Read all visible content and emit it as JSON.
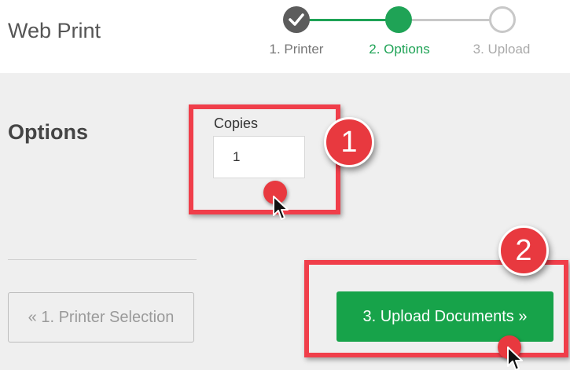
{
  "header": {
    "app_title": "Web Print"
  },
  "stepper": {
    "steps": [
      {
        "label": "1. Printer",
        "state": "completed"
      },
      {
        "label": "2. Options",
        "state": "active"
      },
      {
        "label": "3. Upload",
        "state": "pending"
      }
    ]
  },
  "options": {
    "section_title": "Options",
    "copies_label": "Copies",
    "copies_value": "1"
  },
  "actions": {
    "prev_label": "« 1. Printer Selection",
    "next_label": "3. Upload Documents »"
  },
  "annotations": {
    "badge_1": "1",
    "badge_2": "2"
  },
  "colors": {
    "accent_green": "#17a34a",
    "annotation_red": "#f03e4a",
    "step_completed": "#5c5c5c"
  }
}
